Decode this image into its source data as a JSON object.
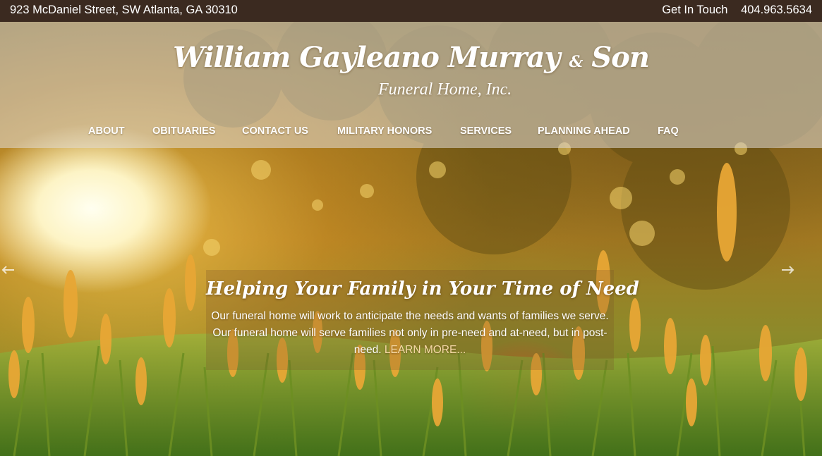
{
  "topbar": {
    "address": "923 McDaniel Street, SW Atlanta, GA 30310",
    "contact_label": "Get In Touch",
    "phone": "404.963.5634"
  },
  "logo": {
    "name_part1": "William Gayleano Murray",
    "ampersand": "&",
    "name_part2": "Son",
    "subtitle": "Funeral Home, Inc."
  },
  "nav": {
    "items": [
      {
        "label": "ABOUT"
      },
      {
        "label": "OBITUARIES"
      },
      {
        "label": "CONTACT US"
      },
      {
        "label": "MILITARY HONORS"
      },
      {
        "label": "SERVICES"
      },
      {
        "label": "PLANNING AHEAD"
      },
      {
        "label": "FAQ"
      }
    ]
  },
  "hero": {
    "title": "Helping Your Family in Your Time of Need",
    "body": "Our funeral home will work to anticipate the needs and wants of families we serve. Our funeral home will serve families not only in pre-need and at-need, but in post-need.",
    "more_link": "LEARN MORE..."
  },
  "icons": {
    "prev": "arrow-left-icon",
    "next": "arrow-right-icon"
  }
}
